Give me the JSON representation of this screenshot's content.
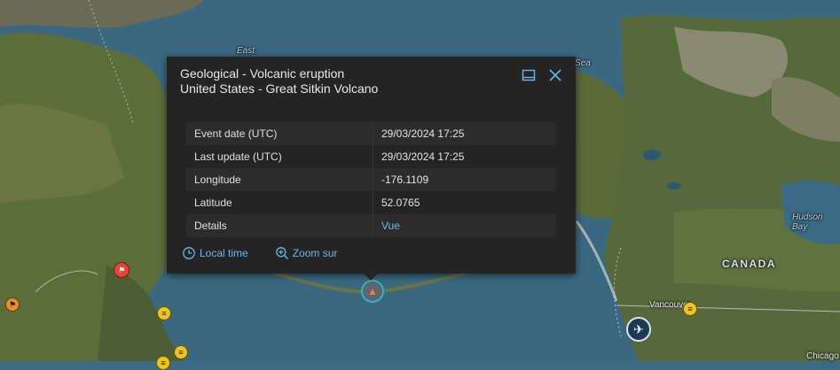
{
  "popup": {
    "title_line1": "Geological - Volcanic eruption",
    "title_line2": "United States - Great Sitkin Volcano",
    "icons": {
      "dock": "dock-icon",
      "close": "close-icon"
    },
    "rows": [
      {
        "key": "Event date (UTC)",
        "value": "29/03/2024 17:25"
      },
      {
        "key": "Last update (UTC)",
        "value": "29/03/2024 17:25"
      },
      {
        "key": "Longitude",
        "value": "-176.1109"
      },
      {
        "key": "Latitude",
        "value": "52.0765"
      },
      {
        "key": "Details",
        "value": "Vue"
      }
    ],
    "actions": {
      "local_time": "Local time",
      "zoom": "Zoom sur"
    }
  },
  "map": {
    "labels": {
      "canada": "CANADA",
      "hudson": "Hudson Bay",
      "vancouver": "Vancouver",
      "chicago": "Chicago",
      "east": "East",
      "sea": "Sea"
    }
  },
  "colors": {
    "accent": "#6fb6e8",
    "popup_bg": "#242424",
    "water": "#3c6a82"
  }
}
